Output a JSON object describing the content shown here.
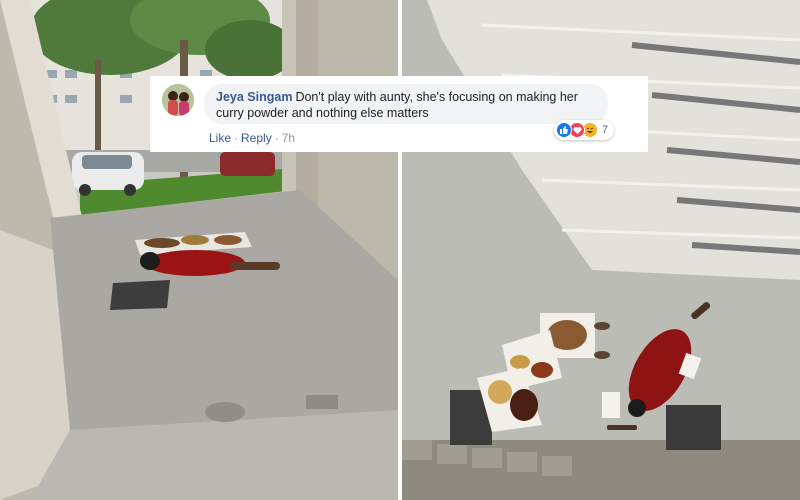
{
  "comment": {
    "author": "Jeya Singam",
    "text": "Don't play with aunty, she's focusing on making her curry powder and nothing else matters",
    "actions": {
      "like": "Like",
      "separator": "·",
      "reply": "Reply",
      "time": "7h"
    },
    "reactions": {
      "icons": [
        "like-icon",
        "love-icon",
        "haha-icon"
      ],
      "count": "7"
    }
  },
  "colors": {
    "author_link": "#385898",
    "bubble": "#f2f3f5",
    "like": "#1877f2",
    "love": "#f33e58",
    "haha": "#f7b125"
  }
}
